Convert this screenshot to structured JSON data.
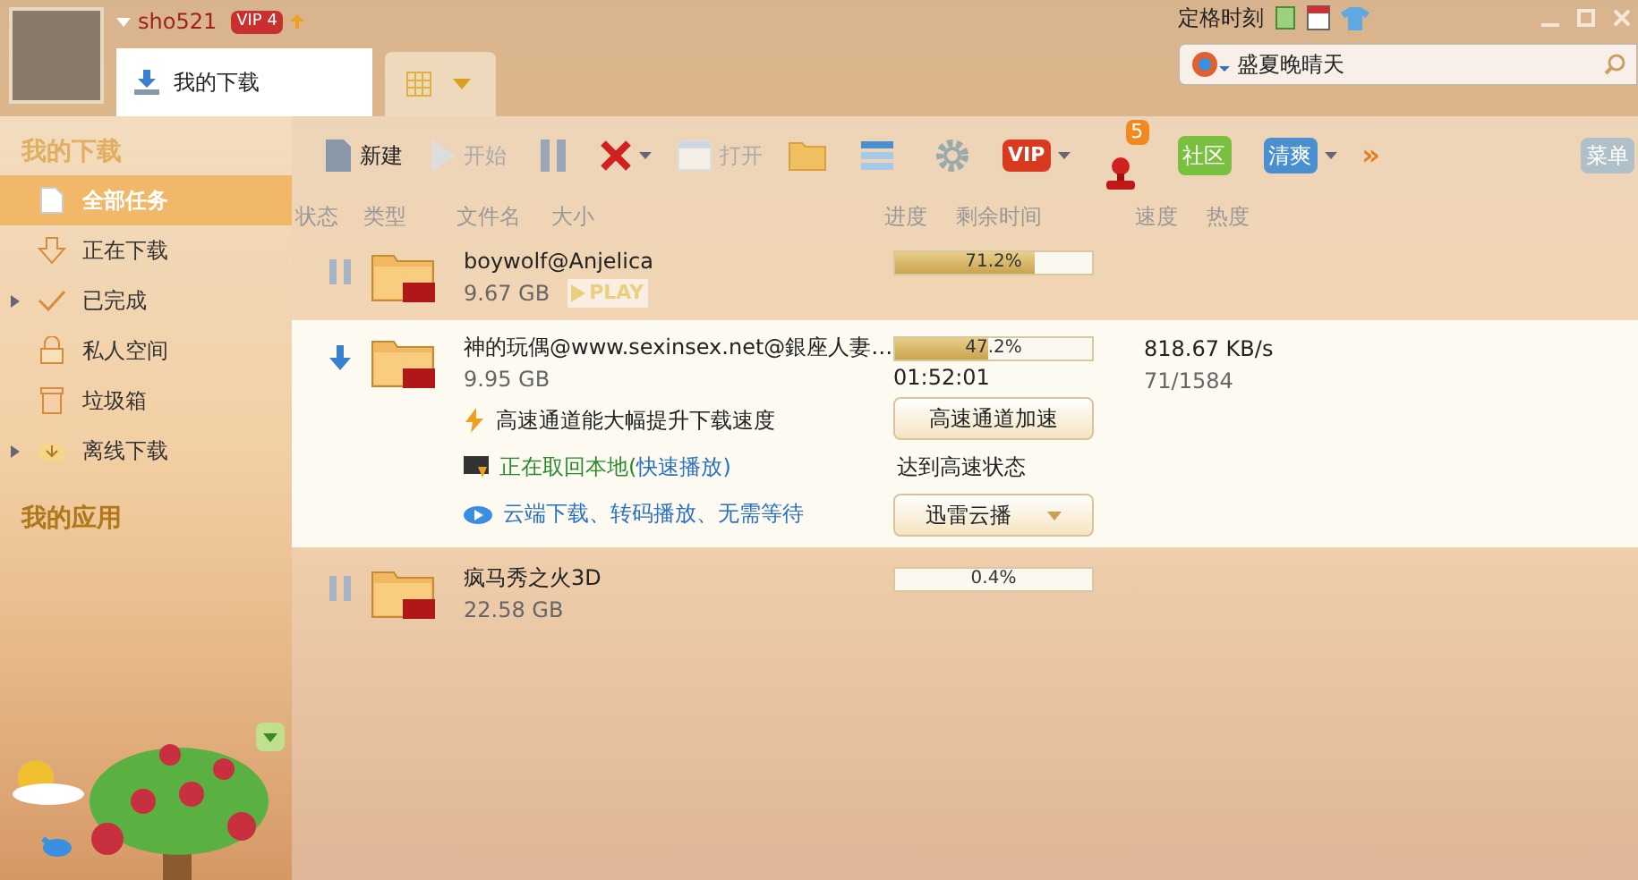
{
  "user": {
    "name": "sho521",
    "vip": "VIP 4"
  },
  "tab": {
    "label": "我的下载",
    "selected": true
  },
  "top_right": {
    "label": "定格时刻"
  },
  "search": {
    "value": "盛夏晚晴天"
  },
  "sidebar": {
    "title": "我的下载",
    "items": [
      {
        "label": "全部任务",
        "expandable": false,
        "selected": true
      },
      {
        "label": "正在下载",
        "expandable": false,
        "selected": false
      },
      {
        "label": "已完成",
        "expandable": true,
        "selected": false
      },
      {
        "label": "私人空间",
        "expandable": false,
        "selected": false
      },
      {
        "label": "垃圾箱",
        "expandable": false,
        "selected": false
      },
      {
        "label": "离线下载",
        "expandable": true,
        "selected": false
      }
    ],
    "apps_title": "我的应用"
  },
  "toolbar": [
    {
      "kind": "new",
      "label": "新建",
      "disabled": false
    },
    {
      "kind": "start",
      "label": "开始",
      "disabled": true
    },
    {
      "kind": "pause"
    },
    {
      "kind": "delete"
    },
    {
      "kind": "open",
      "label": "打开",
      "disabled": true
    },
    {
      "kind": "folder"
    },
    {
      "kind": "list"
    },
    {
      "kind": "settings"
    },
    {
      "kind": "vip",
      "label": "VIP"
    },
    {
      "kind": "game",
      "badge": "5"
    },
    {
      "kind": "community",
      "label": "社区"
    },
    {
      "kind": "skin",
      "label": "清爽"
    },
    {
      "kind": "more",
      "label": "»"
    }
  ],
  "menu_button": "菜单",
  "columns": [
    "状态",
    "类型",
    "文件名",
    "大小",
    "进度",
    "剩余时间",
    "速度",
    "热度"
  ],
  "tasks": [
    {
      "kind": "paused",
      "name": "boywolf@Anjelica",
      "size": "9.67 GB",
      "play": "PLAY",
      "level": 0.712,
      "progress": "71.2%",
      "selected": false
    },
    {
      "kind": "downloading",
      "name": "神的玩偶@www.sexinsex.net@銀座人妻…",
      "size": "9.95 GB",
      "level": 0.472,
      "progress": "47.2%",
      "remaining": "01:52:01",
      "speed": "818.67 KB/s",
      "heat": "71/1584",
      "selected": true,
      "tips": [
        {
          "kind": "bolt",
          "text": "高速通道能大幅提升下载速度"
        },
        {
          "kind": "local",
          "text": "正在取回本地(",
          "link": "快速播放)"
        },
        {
          "kind": "cloud",
          "link": "云端下载、转码播放、无需等待"
        }
      ],
      "accel_button": "高速通道加速",
      "accel_status": "达到高速状态",
      "play_dropdown": "迅雷云播"
    },
    {
      "kind": "paused",
      "name": "疯马秀之火3D",
      "size": "22.58 GB",
      "level": 0.004,
      "progress": "0.4%",
      "selected": false
    }
  ]
}
